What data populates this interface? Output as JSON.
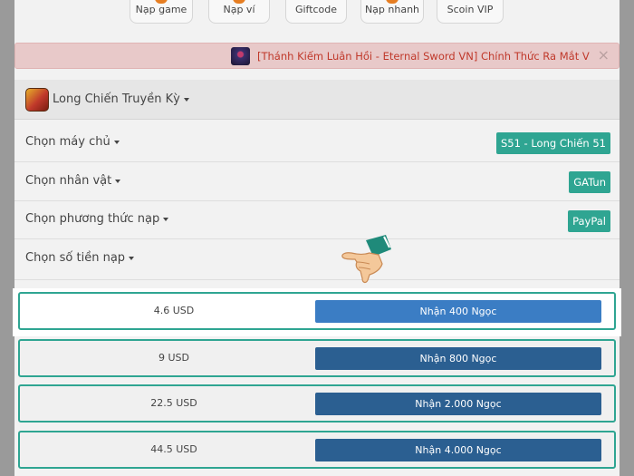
{
  "nav_tabs": [
    {
      "label": "Nạp game",
      "icon": "game-icon",
      "color": "#e67e22"
    },
    {
      "label": "Nạp ví",
      "icon": "wallet-icon",
      "color": "#e67e22"
    },
    {
      "label": "Giftcode",
      "icon": "gift-icon",
      "color": ""
    },
    {
      "label": "Nạp nhanh",
      "icon": "flash-icon",
      "color": "#e67e22"
    },
    {
      "label": "Scoin VIP",
      "icon": "vip-icon",
      "color": ""
    }
  ],
  "announcement": {
    "text": "[Thánh Kiếm Luân Hồi - Eternal Sword VN] Chính Thức Ra Mắt V",
    "close": "×"
  },
  "game": {
    "name": "Long Chiến Truyền Kỳ"
  },
  "options": [
    {
      "label": "Chọn máy chủ",
      "value": "S51 - Long Chiến 51"
    },
    {
      "label": "Chọn nhân vật",
      "value": "GATun"
    },
    {
      "label": "Chọn phương thức nạp",
      "value": "PayPal"
    },
    {
      "label": "Chọn số tiền nạp",
      "value": ""
    }
  ],
  "amounts": [
    {
      "price": "4.6 USD",
      "receive": "Nhận 400 Ngọc",
      "highlighted": true
    },
    {
      "price": "9 USD",
      "receive": "Nhận 800 Ngọc",
      "highlighted": false
    },
    {
      "price": "22.5 USD",
      "receive": "Nhận 2.000 Ngọc",
      "highlighted": false
    },
    {
      "price": "44.5 USD",
      "receive": "Nhận 4.000 Ngọc",
      "highlighted": false
    }
  ],
  "colors": {
    "accent": "#2fa592",
    "button": "#2b5f91",
    "button_selected": "#3b7dc4",
    "announce_text": "#c0392b"
  }
}
